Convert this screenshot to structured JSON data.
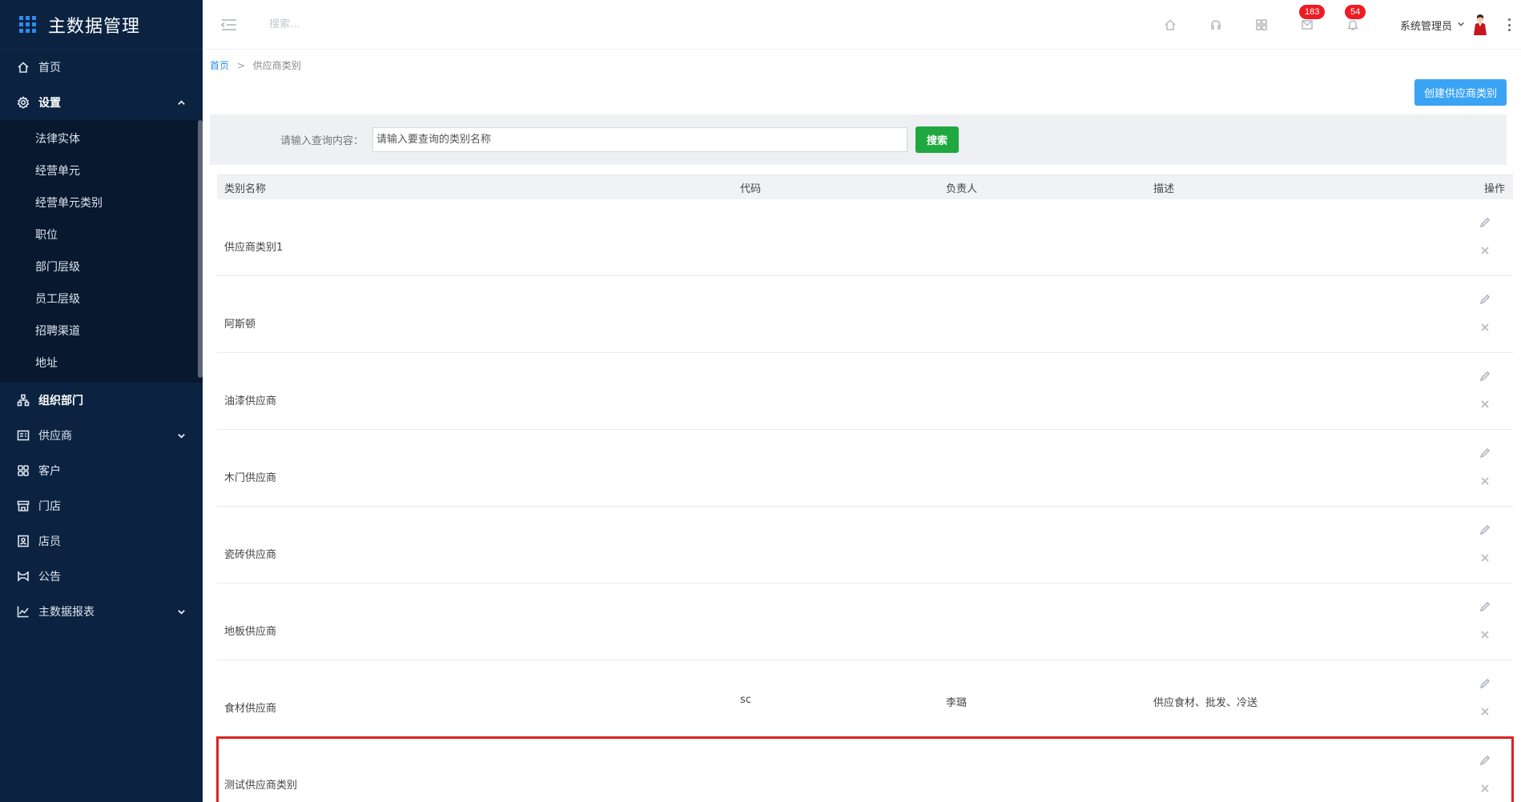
{
  "app": {
    "title": "主数据管理"
  },
  "sidebar": {
    "items": [
      {
        "label": "首页",
        "icon": "home-icon"
      },
      {
        "label": "设置",
        "icon": "gear-icon",
        "expanded": true,
        "children": [
          "法律实体",
          "经营单元",
          "经营单元类别",
          "职位",
          "部门层级",
          "员工层级",
          "招聘渠道",
          "地址"
        ]
      },
      {
        "label": "组织部门",
        "icon": "org-icon"
      },
      {
        "label": "供应商",
        "icon": "supplier-icon"
      },
      {
        "label": "客户",
        "icon": "customer-icon"
      },
      {
        "label": "门店",
        "icon": "store-icon"
      },
      {
        "label": "店员",
        "icon": "clerk-icon"
      },
      {
        "label": "公告",
        "icon": "announcement-icon"
      },
      {
        "label": "主数据报表",
        "icon": "chart-icon"
      }
    ]
  },
  "header": {
    "search_placeholder": "搜索...",
    "mail_badge": "183",
    "bell_badge": "54",
    "user_name": "系统管理员"
  },
  "breadcrumb": {
    "home": "首页",
    "separator": ">",
    "current": "供应商类别"
  },
  "toolbar": {
    "create_label": "创建供应商类别"
  },
  "search": {
    "label": "请输入查询内容：",
    "placeholder": "请输入要查询的类别名称",
    "button_label": "搜索"
  },
  "table": {
    "headers": {
      "name": "类别名称",
      "code": "代码",
      "owner": "负责人",
      "desc": "描述",
      "action": "操作"
    },
    "rows": [
      {
        "name": "供应商类别1",
        "code": "",
        "owner": "",
        "desc": ""
      },
      {
        "name": "阿斯顿",
        "code": "",
        "owner": "",
        "desc": ""
      },
      {
        "name": "油漆供应商",
        "code": "",
        "owner": "",
        "desc": ""
      },
      {
        "name": "木门供应商",
        "code": "",
        "owner": "",
        "desc": ""
      },
      {
        "name": "瓷砖供应商",
        "code": "",
        "owner": "",
        "desc": ""
      },
      {
        "name": "地板供应商",
        "code": "",
        "owner": "",
        "desc": ""
      },
      {
        "name": "食材供应商",
        "code": "sc",
        "owner": "李璐",
        "desc": "供应食材、批发、冷送"
      },
      {
        "name": "测试供应商类别",
        "code": "",
        "owner": "",
        "desc": ""
      }
    ]
  },
  "colors": {
    "sidebar_bg": "#0b2341",
    "accent": "#2d8cf0",
    "create_btn": "#3aa3f3",
    "search_btn": "#1fa83f",
    "badge": "#ed1c24",
    "highlight": "#e02020"
  }
}
